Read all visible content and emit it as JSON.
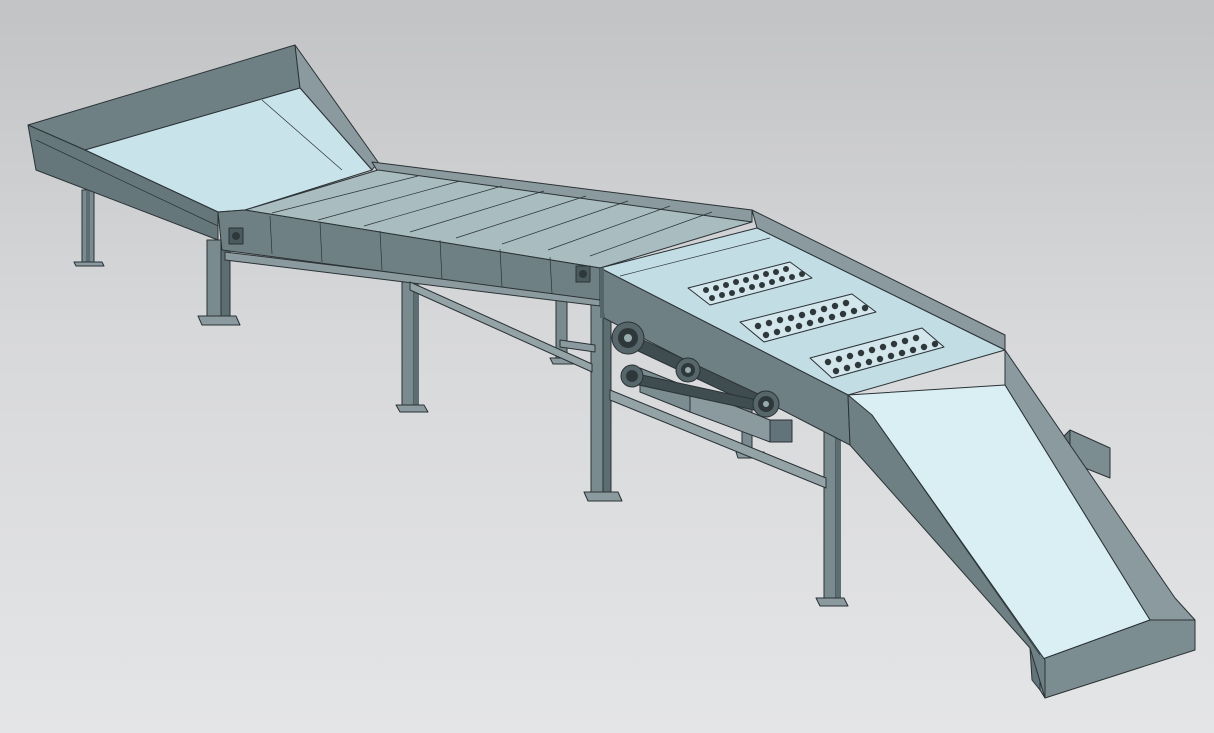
{
  "scene": {
    "model": "conveyor-assembly",
    "colors": {
      "background_top": "#c2c3c5",
      "background_bottom": "#e4e5e7",
      "steel": "#6e8084",
      "steel_dark": "#55666a",
      "steel_light": "#8a9a9e",
      "floor": "#c9e3ea",
      "floor_light": "#d9eff4",
      "edge": "#2b3236"
    },
    "parts": [
      {
        "name": "input-hopper"
      },
      {
        "name": "slat-conveyor"
      },
      {
        "name": "perforated-roller-screen"
      },
      {
        "name": "chain-drive"
      },
      {
        "name": "discharge-chute"
      },
      {
        "name": "support-legs"
      },
      {
        "name": "collection-box"
      }
    ],
    "slat_count": 9,
    "roller_count": 3,
    "support_leg_count": 7
  }
}
